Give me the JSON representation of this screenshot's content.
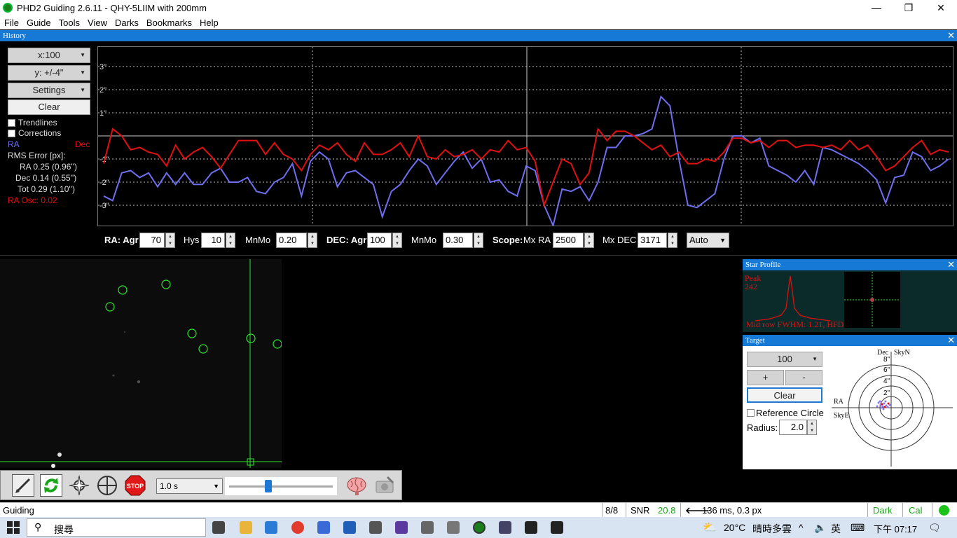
{
  "window": {
    "title": "PHD2 Guiding 2.6.11 - QHY-5LIIM with 200mm",
    "minimize": "—",
    "maximize": "❐",
    "close": "✕"
  },
  "menu": [
    "File",
    "Guide",
    "Tools",
    "View",
    "Darks",
    "Bookmarks",
    "Help"
  ],
  "history": {
    "title": "History",
    "x_scale": "x:100",
    "y_scale": "y: +/-4\"",
    "settings": "Settings",
    "clear": "Clear",
    "trendlines": "Trendlines",
    "corrections": "Corrections",
    "ra_label": "RA",
    "dec_label": "Dec",
    "rms_title": "RMS Error [px]:",
    "rms_ra": "RA 0.25 (0.96'')",
    "rms_dec": "Dec 0.14 (0.55'')",
    "rms_tot": "Tot 0.29 (1.10'')",
    "ra_osc": "RA Osc: 0.02",
    "colors": {
      "ra": "#6e6ef0",
      "dec": "#e01010"
    }
  },
  "chart_data": {
    "type": "line",
    "y_ticks": [
      "3\"",
      "2\"",
      "1\"",
      "-1\"",
      "-2\"",
      "-3\""
    ],
    "ylim": [
      -4,
      4
    ],
    "series": [
      {
        "name": "RA",
        "values": [
          -2.6,
          -2.8,
          -1.6,
          -1.5,
          -1.8,
          -1.6,
          -2.2,
          -1.6,
          -2.1,
          -1.6,
          -2.1,
          -2.1,
          -1.6,
          -1.4,
          -2.0,
          -2.0,
          -1.8,
          -2.4,
          -2.5,
          -2.0,
          -1.8,
          -1.2,
          -2.6,
          -1.1,
          -0.7,
          -1.0,
          -2.2,
          -1.6,
          -1.5,
          -1.8,
          -2.1,
          -3.5,
          -2.4,
          -2.1,
          -1.5,
          -1.0,
          -1.3,
          -2.1,
          -1.6,
          -1.1,
          -0.7,
          -1.4,
          -1.0,
          -2.0,
          -1.9,
          -2.4,
          -2.6,
          -1.3,
          -1.5,
          -3.0,
          -4.0,
          -2.3,
          -2.4,
          -2.2,
          -2.8,
          -2.0,
          -0.5,
          -0.5,
          0.0,
          0.0,
          0.1,
          0.3,
          1.7,
          1.3,
          -1.0,
          -3.0,
          -3.1,
          -2.8,
          -2.5,
          -1.0,
          0.0,
          0.0,
          -0.3,
          -0.1,
          -1.3,
          -1.5,
          -1.7,
          -2.0,
          -1.5,
          -2.1,
          -0.5,
          -0.6,
          -0.8,
          -1.0,
          -1.2,
          -1.5,
          -1.9,
          -2.9,
          -1.8,
          -1.7,
          -0.7,
          -0.9,
          -1.5,
          -1.3,
          -1.0
        ]
      },
      {
        "name": "Dec",
        "values": [
          -1.2,
          0.3,
          0.0,
          -0.6,
          -0.5,
          -0.7,
          -0.8,
          -1.3,
          -0.4,
          -1.0,
          -0.7,
          -0.5,
          -0.9,
          -1.4,
          -0.8,
          -0.2,
          -0.2,
          -0.2,
          -0.8,
          -0.3,
          -0.8,
          -1.0,
          -1.5,
          -0.8,
          -0.4,
          -0.6,
          -0.3,
          -0.8,
          -1.1,
          -0.3,
          -0.8,
          -0.8,
          -0.6,
          -0.3,
          -0.9,
          0.0,
          -0.9,
          -1.0,
          -0.6,
          -0.9,
          -0.8,
          -0.6,
          -1.0,
          -0.6,
          -0.7,
          -0.2,
          -0.6,
          -0.5,
          -1.1,
          -3.0,
          -2.0,
          -1.0,
          -1.2,
          -2.1,
          -1.6,
          0.3,
          -0.2,
          0.2,
          0.2,
          0.0,
          -0.3,
          -0.6,
          -0.4,
          -0.9,
          -0.7,
          -1.2,
          -1.2,
          -1.0,
          -1.1,
          -0.7,
          -0.1,
          -0.1,
          -0.3,
          -0.2,
          -0.5,
          -0.2,
          -0.2,
          -0.5,
          -0.4,
          -0.4,
          -0.5,
          -0.4,
          -0.6,
          -0.2,
          -0.6,
          -0.4,
          -0.9,
          -1.5,
          -1.3,
          -0.9,
          -0.5,
          -0.2,
          -0.8,
          -0.6,
          -0.7
        ]
      }
    ],
    "grid": true
  },
  "params": {
    "ra_agr_label": "RA: Agr",
    "ra_agr": "70",
    "hys_label": "Hys",
    "hys": "10",
    "mnmo_label": "MnMo",
    "ra_mnmo": "0.20",
    "dec_agr_label": "DEC: Agr",
    "dec_agr": "100",
    "mnmo2_label": "MnMo",
    "dec_mnmo": "0.30",
    "scope_label": "Scope:",
    "mxra_label": "Mx RA",
    "mxra": "2500",
    "mxdec_label": "Mx DEC",
    "mxdec": "3171",
    "dec_mode": "Auto"
  },
  "toolbar": {
    "exposure": "1.0 s",
    "slider_fraction": 0.38
  },
  "star_profile": {
    "title": "Star Profile",
    "peak_label": "Peak",
    "peak_value": "242",
    "fwhm": "Mid row FWHM: 1.21, HFD:"
  },
  "target": {
    "title": "Target",
    "scale": "100",
    "plus": "+",
    "minus": "-",
    "clear": "Clear",
    "reference_circle": "Reference Circle",
    "radius_label": "Radius:",
    "radius": "2.0",
    "dec": "Dec",
    "skyn": "SkyN",
    "ra": "RA",
    "skye": "SkyE",
    "rings": [
      "8\"",
      "6\"",
      "4\"",
      "2\""
    ]
  },
  "status": {
    "state": "Guiding",
    "frames": "8/8",
    "snr_label": "SNR",
    "snr": "20.8",
    "pulse": "136 ms, 0.3 px",
    "dark": "Dark",
    "cal": "Cal"
  },
  "taskbar": {
    "search": "搜尋",
    "weather": "20°C",
    "weather_text": "晴時多雲",
    "ime": "英",
    "clock": "下午 07:17"
  }
}
